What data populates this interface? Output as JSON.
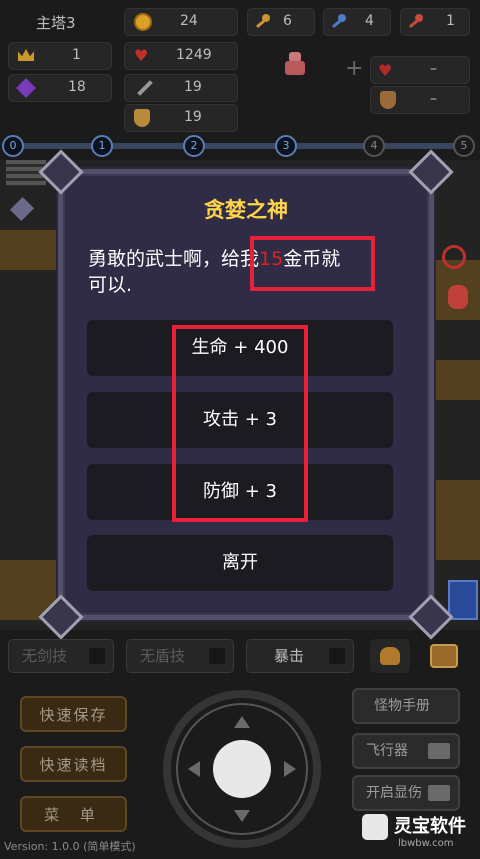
{
  "header": {
    "tower": "主塔3",
    "gold": "24",
    "yellow_keys": "6",
    "blue_keys": "4",
    "red_keys": "1",
    "level": "1",
    "hp": "1249",
    "exp": "18",
    "attack": "19",
    "defense": "19",
    "equip_slot_1": "–",
    "equip_slot_2": "–",
    "plus": "+"
  },
  "floors": [
    "0",
    "1",
    "2",
    "3",
    "4",
    "5"
  ],
  "dialog": {
    "title": "贪婪之神",
    "msg_prefix": "勇敢的武士啊，给我",
    "msg_amount": "15",
    "msg_suffix_line1": "金币就",
    "msg_line2": "可以.",
    "options": [
      "生命 + 400",
      "攻击 + 3",
      "防御 + 3",
      "离开"
    ]
  },
  "skills": {
    "sword": "无剑技",
    "shield": "无盾技",
    "crit": "暴击"
  },
  "left_buttons": {
    "quick_save": "快速保存",
    "quick_load": "快速读档",
    "menu": "菜 单"
  },
  "right_buttons": {
    "monster_manual": "怪物手册",
    "flyer": "飞行器",
    "show_damage": "开启显伤"
  },
  "version": "Version: 1.0.0 (简单模式)",
  "watermark": {
    "name": "灵宝软件",
    "url": "lbwbw.com"
  },
  "colors": {
    "title_yellow": "#ffd54a",
    "highlight_red": "#e8203a",
    "dialog_bg": "#302c45"
  }
}
